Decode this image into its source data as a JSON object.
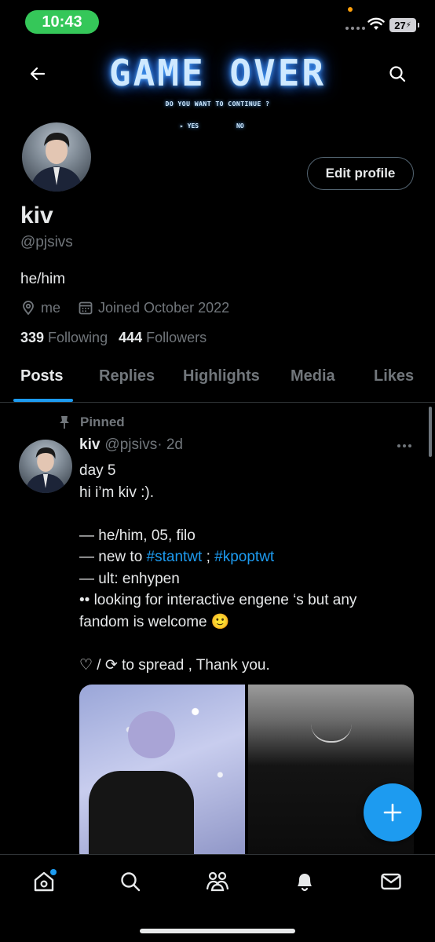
{
  "status_bar": {
    "time": "10:43",
    "battery": "27"
  },
  "banner": {
    "title": "GAME OVER",
    "subtitle": "DO YOU WANT TO CONTINUE ?",
    "yes": "▸ YES",
    "no": "NO"
  },
  "header": {
    "back_icon": "back-arrow-icon",
    "search_icon": "search-icon"
  },
  "profile": {
    "edit_button": "Edit profile",
    "display_name": "kiv",
    "handle": "@pjsivs",
    "bio": "he/him",
    "location": "me",
    "joined": "Joined October 2022",
    "following_count": "339",
    "following_label": "Following",
    "followers_count": "444",
    "followers_label": "Followers"
  },
  "tabs": [
    {
      "label": "Posts",
      "active": true
    },
    {
      "label": "Replies",
      "active": false
    },
    {
      "label": "Highlights",
      "active": false
    },
    {
      "label": "Media",
      "active": false
    },
    {
      "label": "Likes",
      "active": false
    }
  ],
  "pinned_post": {
    "pinned_label": "Pinned",
    "author_name": "kiv",
    "author_handle": "@pjsivs",
    "time": " · 2d",
    "lines": [
      "day 5",
      "hi i’m kiv :).",
      "",
      "— he/him, 05, filo",
      "— new to ",
      "— ult: enhypen",
      "•• looking for interactive engene ‘s but any",
      "fandom is welcome 🙂",
      "",
      "♡ / ⟳ to spread , Thank you."
    ],
    "hashtag_1": "#stantwt",
    "hashtag_sep": " ; ",
    "hashtag_2": "#kpoptwt"
  },
  "colors": {
    "accent": "#1d9bf0",
    "background": "#000000",
    "muted": "#71767b",
    "text": "#e7e9ea",
    "status_green": "#35c759"
  },
  "bottom_nav": [
    "home-icon",
    "search-icon",
    "communities-icon",
    "notifications-icon",
    "messages-icon"
  ]
}
